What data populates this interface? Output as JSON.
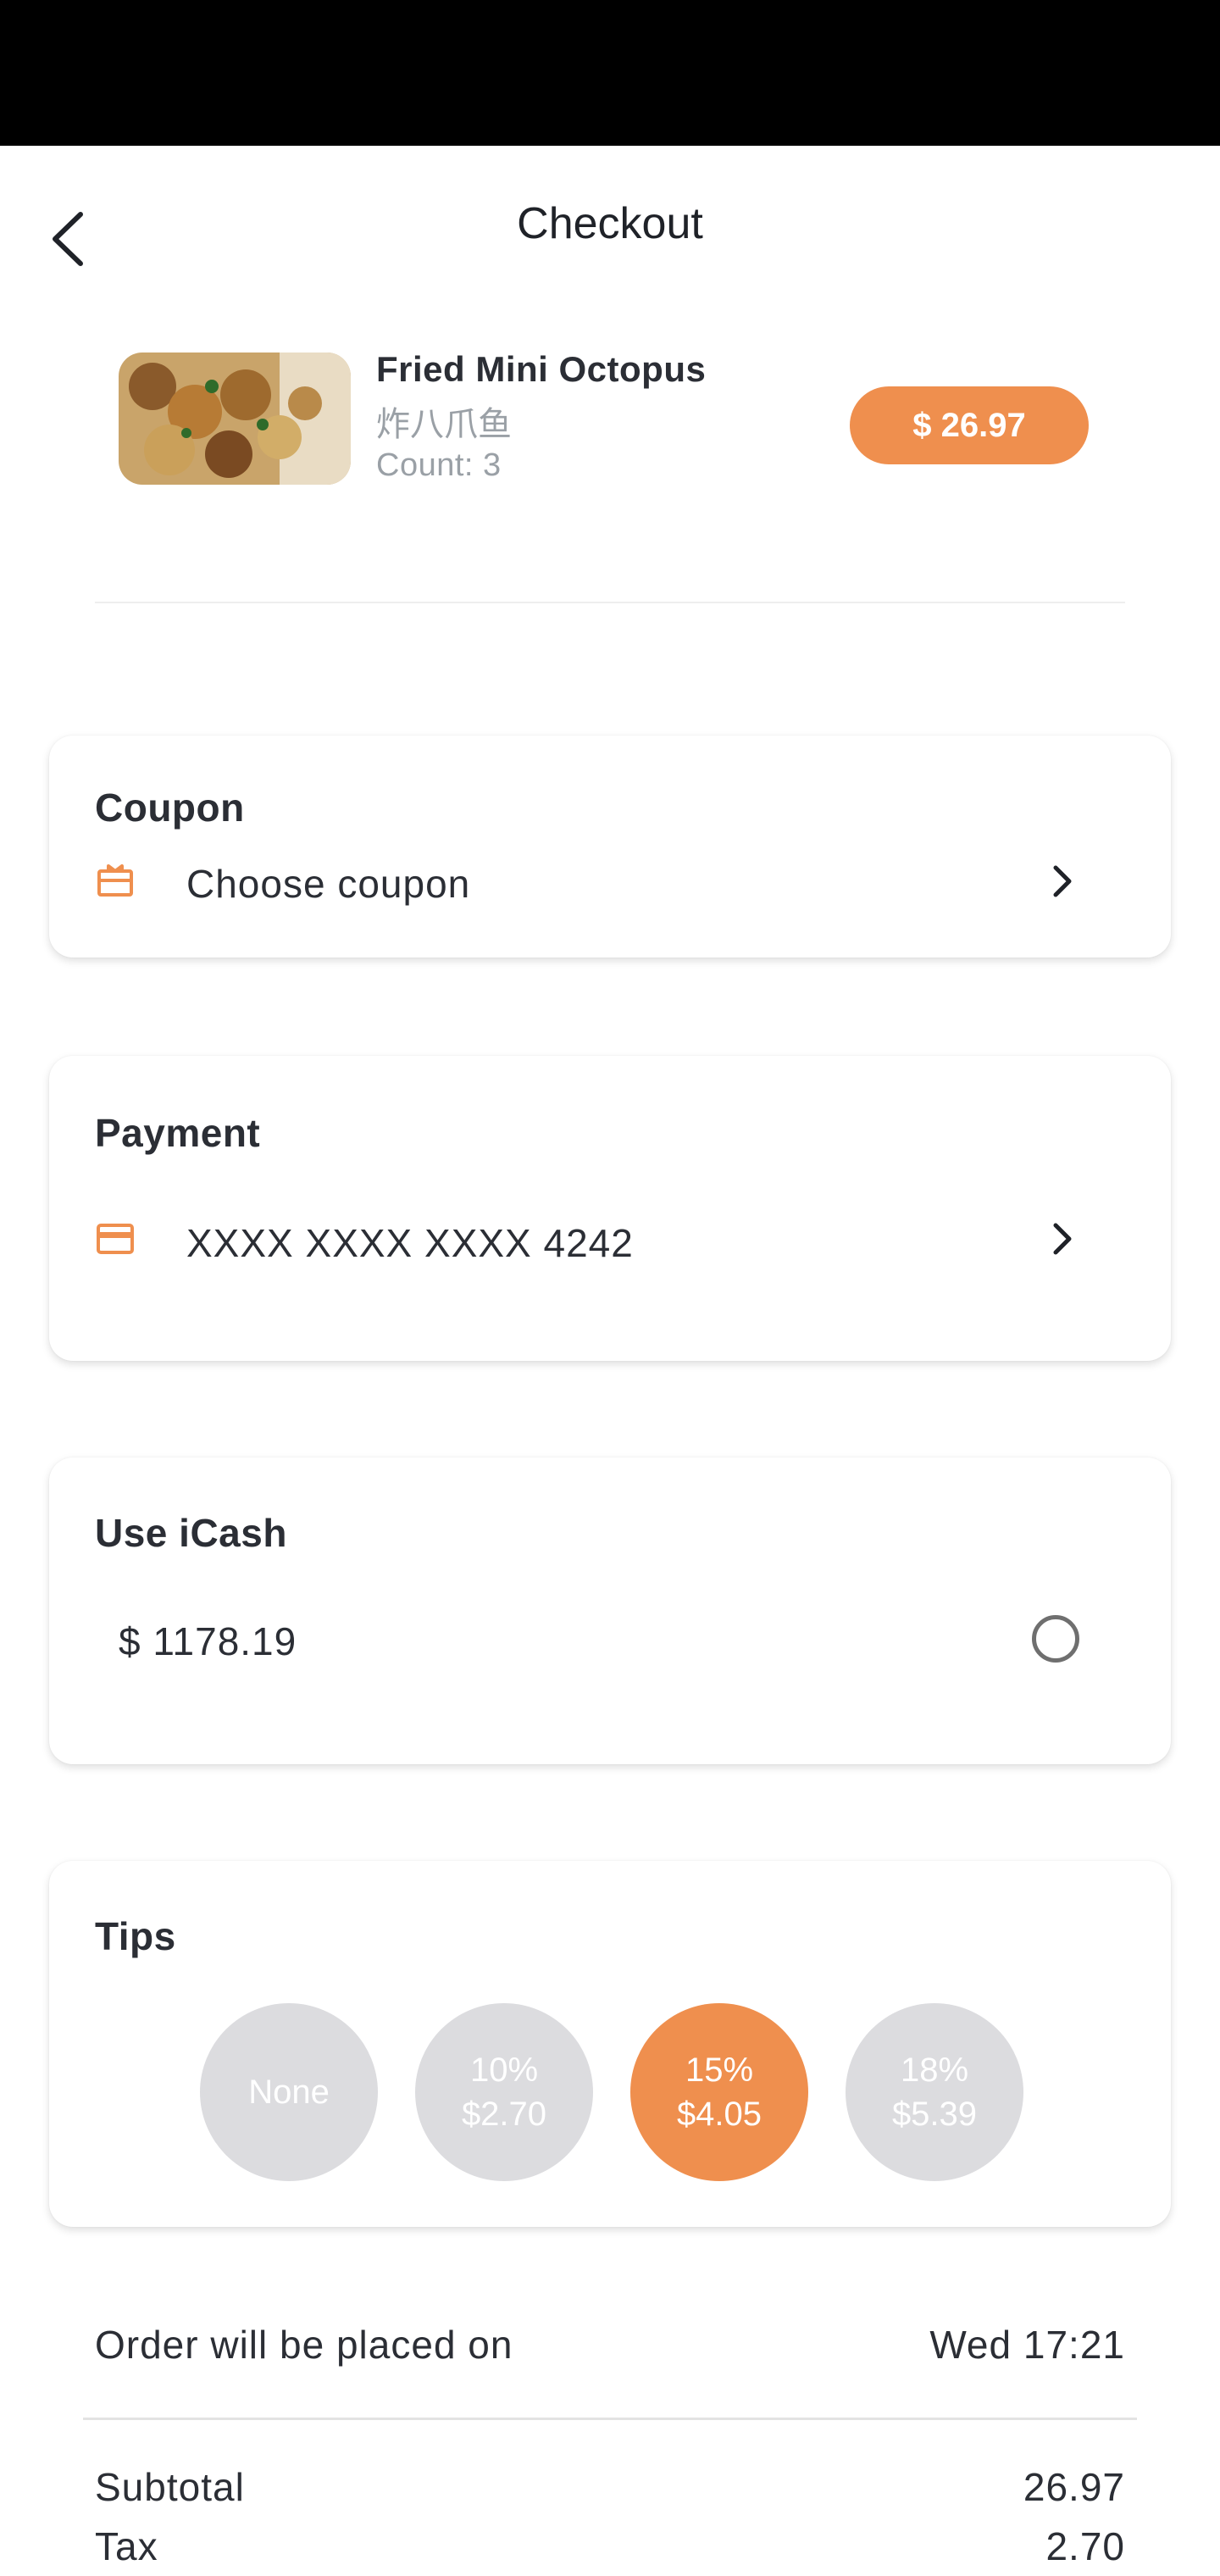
{
  "header": {
    "title": "Checkout"
  },
  "cart_item": {
    "name": "Fried Mini Octopus",
    "name_cn": "炸八爪鱼",
    "count": "Count: 3",
    "price": "$ 26.97"
  },
  "coupon": {
    "title": "Coupon",
    "label": "Choose coupon",
    "icon": "gift-icon"
  },
  "payment": {
    "title": "Payment",
    "card": "XXXX XXXX XXXX 4242",
    "icon": "credit-card-icon"
  },
  "icash": {
    "title": "Use iCash",
    "balance": "$ 1178.19",
    "selected": false
  },
  "tips": {
    "title": "Tips",
    "options": [
      {
        "line1": "None",
        "line2": "",
        "selected": false
      },
      {
        "line1": "10%",
        "line2": "$2.70",
        "selected": false
      },
      {
        "line1": "15%",
        "line2": "$4.05",
        "selected": true
      },
      {
        "line1": "18%",
        "line2": "$5.39",
        "selected": false
      }
    ]
  },
  "order": {
    "label": "Order will be placed on",
    "time": "Wed 17:21"
  },
  "summary": {
    "subtotal_label": "Subtotal",
    "subtotal_value": "26.97",
    "tax_label": "Tax",
    "tax_value": "2.70"
  },
  "colors": {
    "accent": "#ef8f4e",
    "tip_inactive": "#dcdcdf"
  }
}
